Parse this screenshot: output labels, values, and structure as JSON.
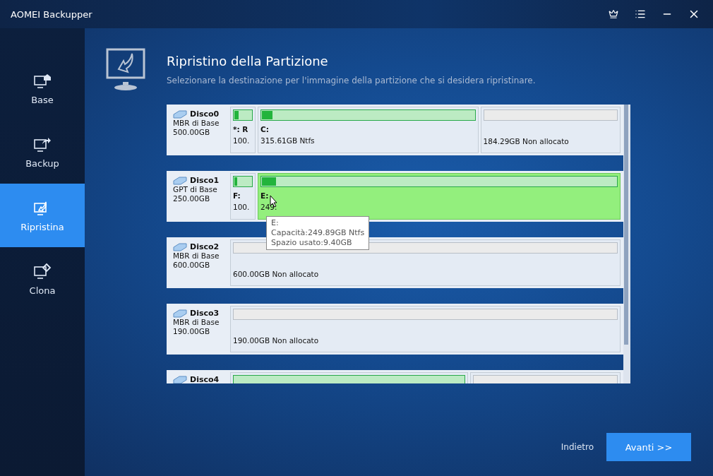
{
  "window": {
    "title": "AOMEI Backupper"
  },
  "sidebar": {
    "items": [
      {
        "label": "Base",
        "selected": false
      },
      {
        "label": "Backup",
        "selected": false
      },
      {
        "label": "Ripristina",
        "selected": true
      },
      {
        "label": "Clona",
        "selected": false
      }
    ]
  },
  "header": {
    "title": "Ripristino della Partizione",
    "subtitle": "Selezionare la destinazione per l'immagine della partizione che si desidera ripristinare."
  },
  "disks": [
    {
      "name": "Disco0",
      "type": "MBR di Base",
      "size": "500.00GB",
      "partitions": [
        {
          "kind": "system",
          "label": "*: R",
          "size": "100.",
          "level": 0.25,
          "selected": false
        },
        {
          "kind": "data",
          "label": "C:",
          "size": "315.61GB Ntfs",
          "level": 0.05,
          "selected": false
        },
        {
          "kind": "unallocated",
          "size": "184.29GB Non allocato",
          "selected": false
        }
      ]
    },
    {
      "name": "Disco1",
      "type": "GPT di Base",
      "size": "250.00GB",
      "partitions": [
        {
          "kind": "system",
          "label": "F:",
          "size": "100.",
          "level": 0.05,
          "selected": false
        },
        {
          "kind": "data",
          "label": "E:",
          "size": "249.",
          "level": 0.04,
          "selected": true
        }
      ]
    },
    {
      "name": "Disco2",
      "type": "MBR di Base",
      "size": "600.00GB",
      "partitions": [
        {
          "kind": "unallocated",
          "size": "600.00GB Non allocato",
          "selected": false
        }
      ]
    },
    {
      "name": "Disco3",
      "type": "MBR di Base",
      "size": "190.00GB",
      "partitions": [
        {
          "kind": "unallocated",
          "size": "190.00GB Non allocato",
          "selected": false
        }
      ]
    },
    {
      "name": "Disco4",
      "partitions": [
        {
          "kind": "data",
          "selected": false
        },
        {
          "kind": "unallocated",
          "selected": false
        }
      ]
    }
  ],
  "tooltip": {
    "lines": [
      "E:",
      "Capacità:249.89GB Ntfs",
      "Spazio usato:9.40GB"
    ]
  },
  "buttons": {
    "back": "Indietro",
    "next": "Avanti >>"
  }
}
